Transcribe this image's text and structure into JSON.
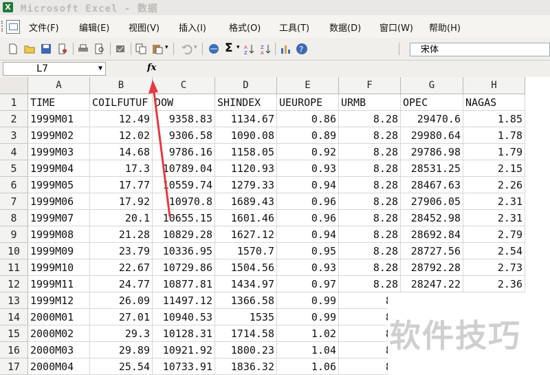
{
  "window": {
    "title": "Microsoft Excel - 数据"
  },
  "menu": [
    "文件(F)",
    "编辑(E)",
    "视图(V)",
    "插入(I)",
    "格式(O)",
    "工具(T)",
    "数据(D)",
    "窗口(W)",
    "帮助(H)"
  ],
  "toolbar": {
    "icons": [
      "new-icon",
      "open-icon",
      "save-icon",
      "permission-icon",
      "print-icon",
      "print-preview-icon",
      "spell-check-icon",
      "copy-icon",
      "paste-icon",
      "undo-icon",
      "hyperlink-icon",
      "sum-icon",
      "sort-ascending-icon",
      "sort-descending-icon",
      "chart-wizard-icon",
      "help-icon"
    ],
    "sum_glyph": "Σ",
    "font_name": "宋体"
  },
  "formula_bar": {
    "name_box": "L7",
    "fx": "fx",
    "formula": ""
  },
  "columns": [
    "A",
    "B",
    "C",
    "D",
    "E",
    "F",
    "G",
    "H"
  ],
  "rows": [
    {
      "n": "1",
      "cells": [
        "TIME",
        "COILFUTUF",
        "DOW",
        "SHINDEX",
        "UEUROPE",
        "URMB",
        "OPEC",
        "NAGAS"
      ]
    },
    {
      "n": "2",
      "cells": [
        "1999M01",
        "12.49",
        "9358.83",
        "1134.67",
        "0.86",
        "8.28",
        "29470.6",
        "1.85"
      ]
    },
    {
      "n": "3",
      "cells": [
        "1999M02",
        "12.02",
        "9306.58",
        "1090.08",
        "0.89",
        "8.28",
        "29980.64",
        "1.78"
      ]
    },
    {
      "n": "4",
      "cells": [
        "1999M03",
        "14.68",
        "9786.16",
        "1158.05",
        "0.92",
        "8.28",
        "29786.98",
        "1.79"
      ]
    },
    {
      "n": "5",
      "cells": [
        "1999M04",
        "17.3",
        "10789.04",
        "1120.93",
        "0.93",
        "8.28",
        "28531.25",
        "2.15"
      ]
    },
    {
      "n": "6",
      "cells": [
        "1999M05",
        "17.77",
        "10559.74",
        "1279.33",
        "0.94",
        "8.28",
        "28467.63",
        "2.26"
      ]
    },
    {
      "n": "7",
      "cells": [
        "1999M06",
        "17.92",
        "10970.8",
        "1689.43",
        "0.96",
        "8.28",
        "27906.05",
        "2.31"
      ]
    },
    {
      "n": "8",
      "cells": [
        "1999M07",
        "20.1",
        "10655.15",
        "1601.46",
        "0.96",
        "8.28",
        "28452.98",
        "2.31"
      ]
    },
    {
      "n": "9",
      "cells": [
        "1999M08",
        "21.28",
        "10829.28",
        "1627.12",
        "0.94",
        "8.28",
        "28692.84",
        "2.79"
      ]
    },
    {
      "n": "10",
      "cells": [
        "1999M09",
        "23.79",
        "10336.95",
        "1570.7",
        "0.95",
        "8.28",
        "28727.56",
        "2.54"
      ]
    },
    {
      "n": "11",
      "cells": [
        "1999M10",
        "22.67",
        "10729.86",
        "1504.56",
        "0.93",
        "8.28",
        "28792.28",
        "2.73"
      ]
    },
    {
      "n": "12",
      "cells": [
        "1999M11",
        "24.77",
        "10877.81",
        "1434.97",
        "0.97",
        "8.28",
        "28247.22",
        "2.36"
      ]
    },
    {
      "n": "13",
      "cells": [
        "1999M12",
        "26.09",
        "11497.12",
        "1366.58",
        "0.99",
        "8.",
        "",
        ""
      ]
    },
    {
      "n": "14",
      "cells": [
        "2000M01",
        "27.01",
        "10940.53",
        "1535",
        "0.99",
        "8.",
        "",
        ""
      ]
    },
    {
      "n": "15",
      "cells": [
        "2000M02",
        "29.3",
        "10128.31",
        "1714.58",
        "1.02",
        "8.",
        "",
        ""
      ]
    },
    {
      "n": "16",
      "cells": [
        "2000M03",
        "29.89",
        "10921.92",
        "1800.23",
        "1.04",
        "8.",
        "",
        ""
      ]
    },
    {
      "n": "17",
      "cells": [
        "2000M04",
        "25.54",
        "10733.91",
        "1836.32",
        "1.06",
        "8.",
        "",
        ""
      ]
    }
  ],
  "watermark": "软件技巧",
  "colors": {
    "arrow": "#e8383d",
    "grid_line": "#d6d6d3",
    "header_bg": "#f3f3f1",
    "excel_green": "#1f7a3a"
  }
}
